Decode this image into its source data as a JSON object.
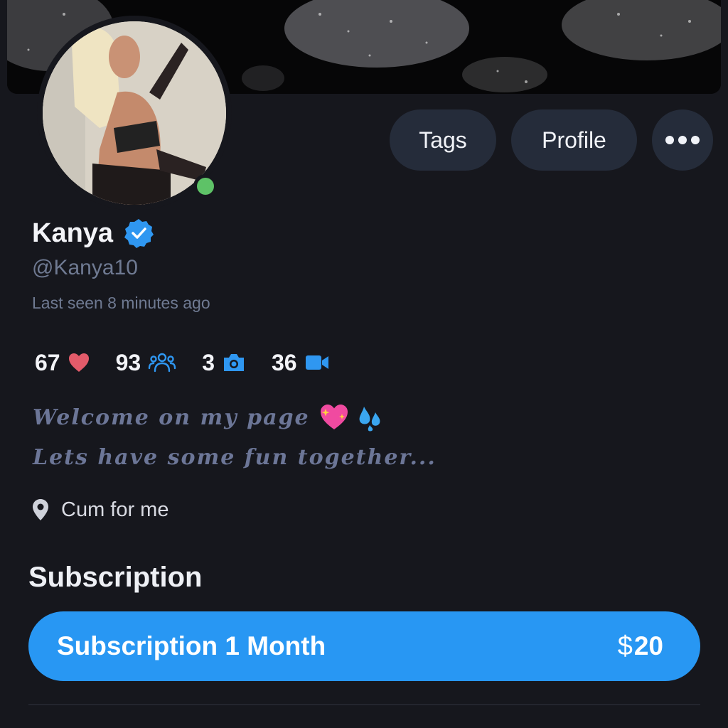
{
  "header": {
    "buttons": {
      "tags_label": "Tags",
      "profile_label": "Profile",
      "more_icon": "more-dots-icon"
    }
  },
  "profile": {
    "name": "Kanya",
    "verified_icon": "verified-badge-icon",
    "handle": "@Kanya10",
    "last_seen": "Last seen 8 minutes ago",
    "online_status_color": "#5ec267",
    "stats": [
      {
        "value": "67",
        "icon": "heart-icon",
        "color": "#e35b6a"
      },
      {
        "value": "93",
        "icon": "users-icon",
        "color": "#2f97f1"
      },
      {
        "value": "3",
        "icon": "camera-icon",
        "color": "#2f97f1"
      },
      {
        "value": "36",
        "icon": "video-icon",
        "color": "#2f97f1"
      }
    ],
    "bio": {
      "line1": "Welcome on my page",
      "line1_emojis": [
        "💖",
        "💦"
      ],
      "line2": "Lets have some fun together..."
    },
    "location": {
      "icon": "location-pin-icon",
      "text": "Cum for me"
    }
  },
  "subscription": {
    "section_title": "Subscription",
    "plan_label": "Subscription 1 Month",
    "currency": "$",
    "price": "20",
    "accent_color": "#2897f3"
  }
}
